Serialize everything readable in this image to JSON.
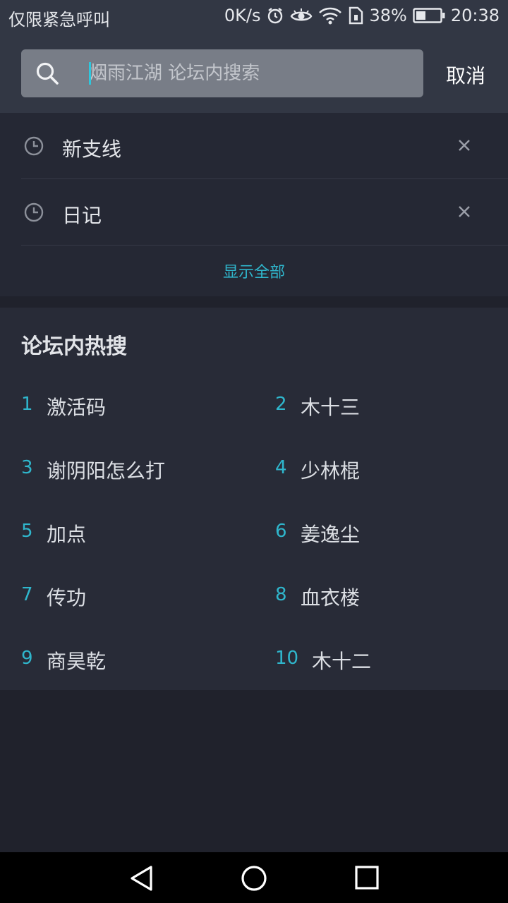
{
  "status_bar": {
    "carrier_text": "仅限紧急呼叫",
    "net_speed": "0K/s",
    "battery": "38%",
    "time": "20:38"
  },
  "search": {
    "placeholder": "烟雨江湖 论坛内搜索",
    "value": "",
    "cancel_label": "取消"
  },
  "history": {
    "items": [
      {
        "label": "新支线"
      },
      {
        "label": "日记"
      }
    ],
    "show_all_label": "显示全部"
  },
  "hot_search": {
    "title": "论坛内热搜",
    "items": [
      {
        "rank": "1",
        "term": "激活码"
      },
      {
        "rank": "2",
        "term": "木十三"
      },
      {
        "rank": "3",
        "term": "谢阴阳怎么打"
      },
      {
        "rank": "4",
        "term": "少林棍"
      },
      {
        "rank": "5",
        "term": "加点"
      },
      {
        "rank": "6",
        "term": "姜逸尘"
      },
      {
        "rank": "7",
        "term": "传功"
      },
      {
        "rank": "8",
        "term": "血衣楼"
      },
      {
        "rank": "9",
        "term": "商昊乾"
      },
      {
        "rank": "10",
        "term": "木十二"
      }
    ]
  },
  "colors": {
    "accent": "#2fb6cc",
    "header_bg": "#323744",
    "list_bg": "#282b37"
  },
  "icons": {
    "search": "search-icon",
    "history": "clock-icon",
    "remove": "close-icon",
    "nav_back": "back-triangle-icon",
    "nav_home": "home-circle-icon",
    "nav_recent": "recent-square-icon"
  }
}
